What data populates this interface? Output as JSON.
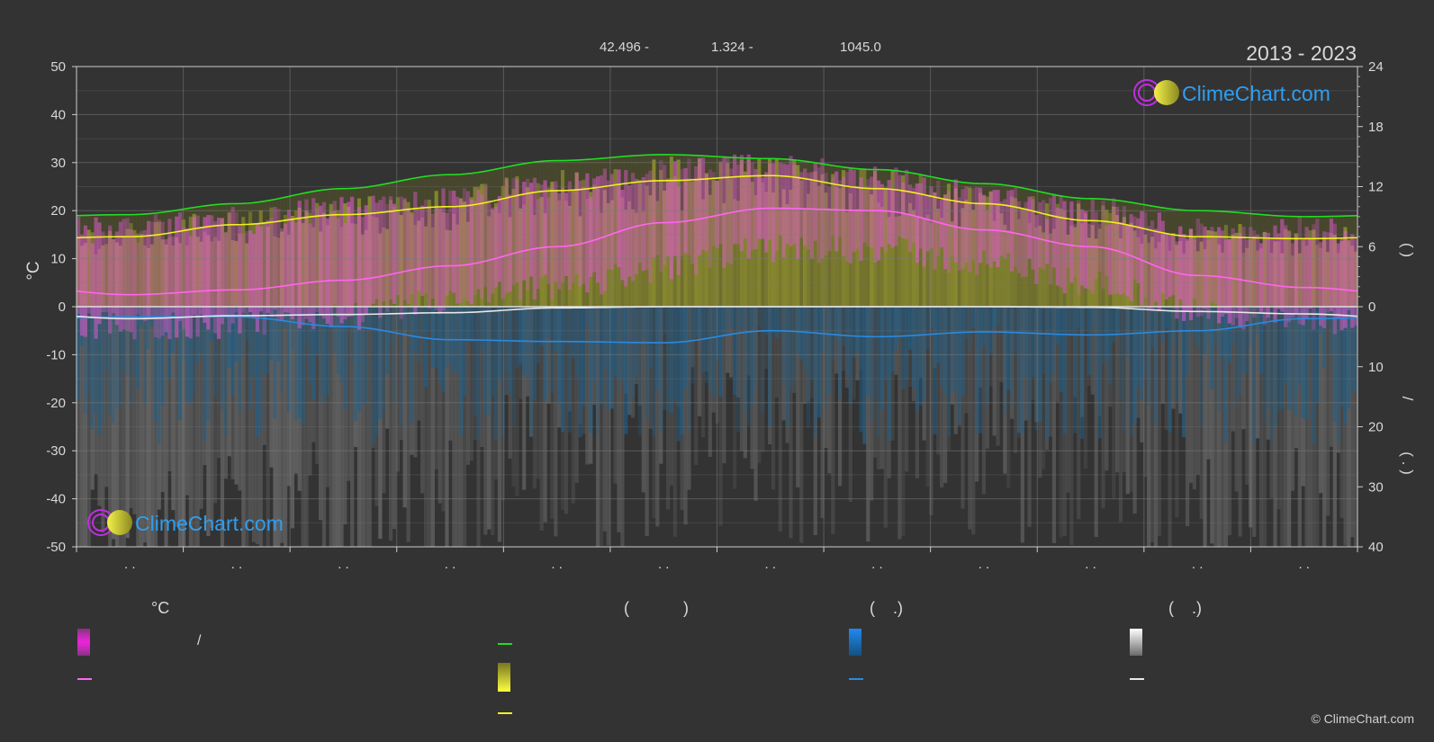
{
  "header": {
    "period": "2013 - 2023",
    "coords": [
      "42.496 -",
      "1.324 -",
      "1045.0"
    ]
  },
  "brand": {
    "name": "ClimeChart.com",
    "copyright": "© ClimeChart.com"
  },
  "colors": {
    "background": "#333333",
    "grid": "#7a7a7a",
    "temp_band": "#e25ad0",
    "sunshine_band": "#9a9a30",
    "daylight_line": "#22dd22",
    "sunshine_line": "#f0f020",
    "mean_temp_line": "#ff66ee",
    "rain_line": "#2a8ae0",
    "snow_line": "#e8e8e8",
    "rain_bars": "#1e5f8a",
    "snow_bars": "#7a7a7a",
    "brand_text": "#2f9ef0"
  },
  "chart_data": {
    "type": "area",
    "months": 12,
    "month_labels": [
      ". .",
      ". .",
      ". .",
      ". .",
      ". .",
      ". .",
      ". .",
      ". .",
      ". .",
      ". .",
      ". .",
      ". ."
    ],
    "x_month_centers": [
      0.5,
      1.5,
      2.5,
      3.5,
      4.5,
      5.5,
      6.5,
      7.5,
      8.5,
      9.5,
      10.5,
      11.5
    ],
    "ylabel_left": "°C",
    "ylim_left": [
      -50,
      50
    ],
    "yticks_left": [
      50,
      40,
      30,
      20,
      10,
      0,
      -10,
      -20,
      -30,
      -40,
      -50
    ],
    "ylim_right_top": [
      0,
      24
    ],
    "yticks_right_top": [
      24,
      18,
      12,
      6,
      0
    ],
    "ylim_right_bottom": [
      0,
      40
    ],
    "yticks_right_bottom": [
      10,
      20,
      30,
      40
    ],
    "right_axis_top_label": "(   )",
    "right_axis_bottom_label": "/",
    "right_axis_bottom_label2": "( .  )",
    "grid": true,
    "series": [
      {
        "key": "daylight",
        "values": [
          9.2,
          10.3,
          11.8,
          13.2,
          14.6,
          15.2,
          14.8,
          13.7,
          12.3,
          10.8,
          9.6,
          9.0
        ]
      },
      {
        "key": "sunshine",
        "values": [
          7.0,
          8.2,
          9.2,
          10.0,
          11.6,
          12.6,
          13.1,
          11.8,
          10.3,
          8.6,
          7.0,
          6.8
        ]
      },
      {
        "key": "mean_temp",
        "values": [
          2.5,
          3.5,
          5.5,
          8.5,
          12.5,
          17.5,
          20.5,
          20.0,
          16.0,
          12.5,
          6.5,
          4.0
        ]
      },
      {
        "key": "rain_mm_day",
        "values": [
          1.7,
          1.7,
          3.3,
          5.5,
          5.8,
          6.0,
          4.0,
          5.0,
          4.2,
          4.7,
          4.0,
          2.0
        ]
      },
      {
        "key": "snow_mm_day",
        "values": [
          2.0,
          1.5,
          1.3,
          1.0,
          0.2,
          0.0,
          0.0,
          0.0,
          0.0,
          0.1,
          0.8,
          1.2
        ]
      }
    ],
    "temp_band": {
      "max": [
        16,
        18,
        20,
        22,
        25,
        28,
        29,
        27,
        23,
        20,
        16,
        16
      ],
      "min": [
        -4,
        -4,
        -2,
        1,
        4,
        8,
        12,
        12,
        9,
        5,
        -1,
        -3
      ]
    }
  },
  "legend": {
    "col1": {
      "header": "°C",
      "item1": "/"
    },
    "col2": {
      "header": "(            )"
    },
    "col3": {
      "header": "(    .)"
    },
    "col4": {
      "header": "(    .)"
    }
  }
}
